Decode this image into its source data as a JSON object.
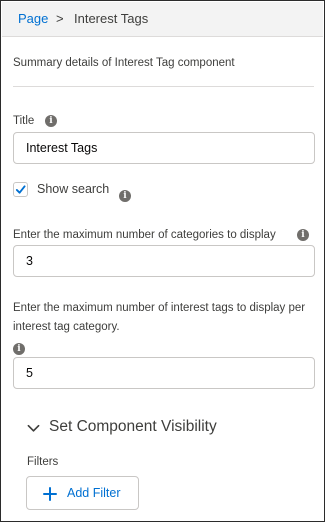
{
  "breadcrumb": {
    "parent": "Page",
    "separator": ">",
    "current": "Interest Tags"
  },
  "summary": "Summary details of Interest Tag component",
  "title_field": {
    "label": "Title",
    "value": "Interest Tags"
  },
  "show_search": {
    "label": "Show search",
    "checked": true
  },
  "max_categories": {
    "label": "Enter the maximum number of categories to display",
    "value": "3"
  },
  "max_tags": {
    "label": "Enter the maximum number of interest tags to display per interest tag category.",
    "value": "5"
  },
  "visibility": {
    "title": "Set Component Visibility"
  },
  "filters": {
    "label": "Filters",
    "add_button": "Add Filter"
  },
  "icons": {
    "info": "info-icon",
    "check": "check-icon",
    "chevron": "chevron-down-icon",
    "add": "plus-icon"
  },
  "colors": {
    "link": "#0070d2",
    "header_bg": "#f3f3f3",
    "text": "#3e3e3c",
    "icon": "#706e6b"
  }
}
